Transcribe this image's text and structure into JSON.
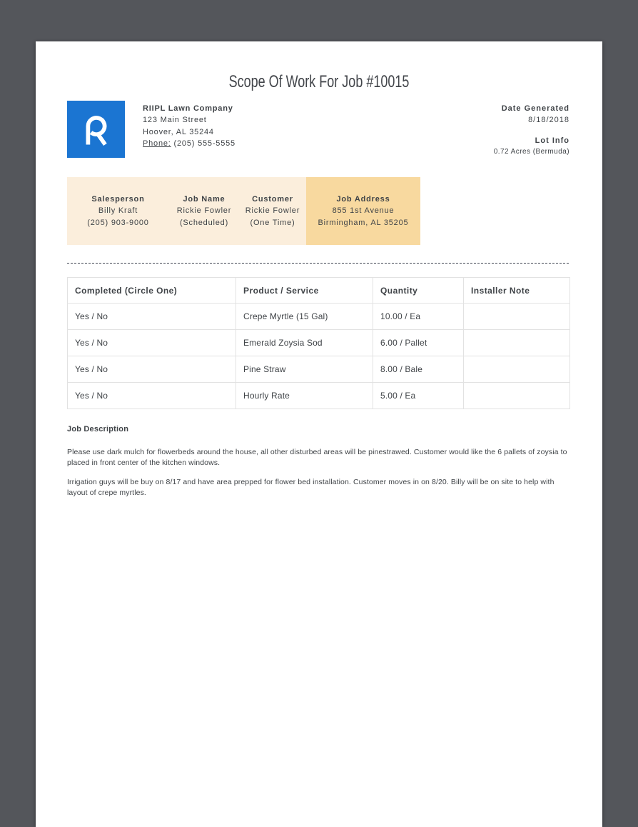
{
  "document": {
    "title": "Scope Of Work For Job #10015",
    "company": {
      "logo_letter": "R",
      "name": "RIIPL Lawn Company",
      "address_line1": "123 Main Street",
      "address_line2": "Hoover, AL 35244",
      "phone_label": "Phone:",
      "phone_number": "(205) 555-5555"
    },
    "meta": {
      "date_generated_label": "Date Generated",
      "date_generated": "8/18/2018",
      "lot_info_label": "Lot Info",
      "lot_info": "0.72 Acres (Bermuda)"
    },
    "job_info_cells": [
      {
        "label": "Salesperson",
        "line1": "Billy Kraft",
        "line2": "(205) 903-9000",
        "highlight": false
      },
      {
        "label": "Job Name",
        "line1": "Rickie Fowler",
        "line2": "(Scheduled)",
        "highlight": false
      },
      {
        "label": "Customer",
        "line1": "Rickie Fowler",
        "line2": "(One Time)",
        "highlight": false
      },
      {
        "label": "Job Address",
        "line1": "855 1st Avenue",
        "line2": "Birmingham, AL 35205",
        "highlight": true
      }
    ],
    "work_table": {
      "headers": [
        "Completed (Circle One)",
        "Product / Service",
        "Quantity",
        "Installer Note"
      ],
      "rows": [
        {
          "completed": "Yes / No",
          "product": "Crepe Myrtle (15 Gal)",
          "quantity": "10.00 / Ea",
          "installer_note": ""
        },
        {
          "completed": "Yes / No",
          "product": "Emerald Zoysia Sod",
          "quantity": "6.00 / Pallet",
          "installer_note": ""
        },
        {
          "completed": "Yes / No",
          "product": "Pine Straw",
          "quantity": "8.00 / Bale",
          "installer_note": ""
        },
        {
          "completed": "Yes / No",
          "product": "Hourly Rate",
          "quantity": "5.00 / Ea",
          "installer_note": ""
        }
      ]
    },
    "job_description": {
      "heading": "Job Description",
      "paragraph1": "Please use dark mulch for flowerbeds around the house, all other disturbed areas will be pinestrawed. Customer would like the 6 pallets of zoysia to placed in front center of the kitchen windows.",
      "paragraph2": "Irrigation guys will be buy on 8/17 and have area prepped for flower bed installation. Customer moves in on 8/20. Billy will be on site to help with layout of crepe myrtles."
    }
  },
  "colors": {
    "background": "#54565b",
    "page": "#ffffff",
    "text": "#3f4347",
    "logo_blue": "#1b75d2",
    "info_bar_cream": "#fbeedc",
    "info_bar_highlight": "#f8d99f",
    "table_border": "#e2e2e2"
  }
}
